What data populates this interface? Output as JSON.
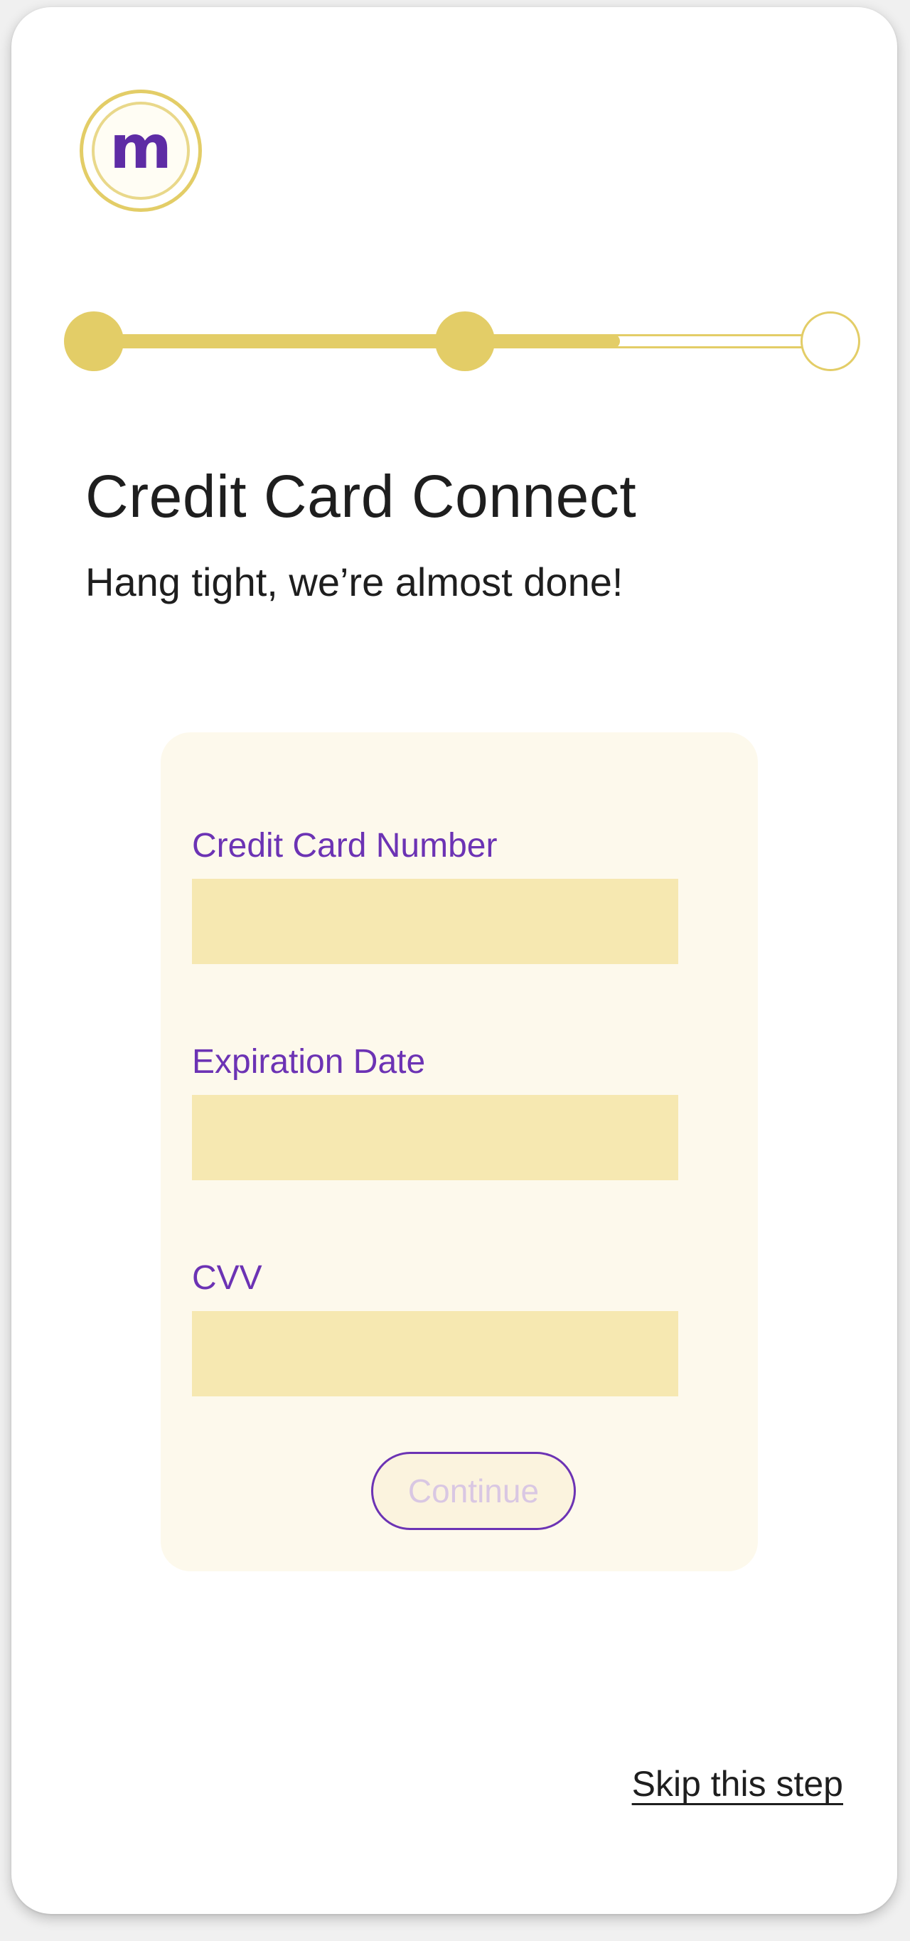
{
  "logo": {
    "letter": "m"
  },
  "stepper": {
    "total_steps": 3,
    "completed_steps": 2,
    "progress_fraction": 0.7
  },
  "header": {
    "title": "Credit Card Connect",
    "subtitle": "Hang tight, we’re almost done!"
  },
  "form": {
    "card_number_label": "Credit Card Number",
    "card_number_value": "",
    "expiration_label": "Expiration Date",
    "expiration_value": "",
    "cvv_label": "CVV",
    "cvv_value": "",
    "continue_label": "Continue"
  },
  "footer": {
    "skip_label": "Skip this step"
  },
  "colors": {
    "accent_gold": "#e3cd67",
    "brand_purple": "#6c33b4",
    "card_background": "#fdf9ec",
    "input_background": "#f6e8b1"
  }
}
